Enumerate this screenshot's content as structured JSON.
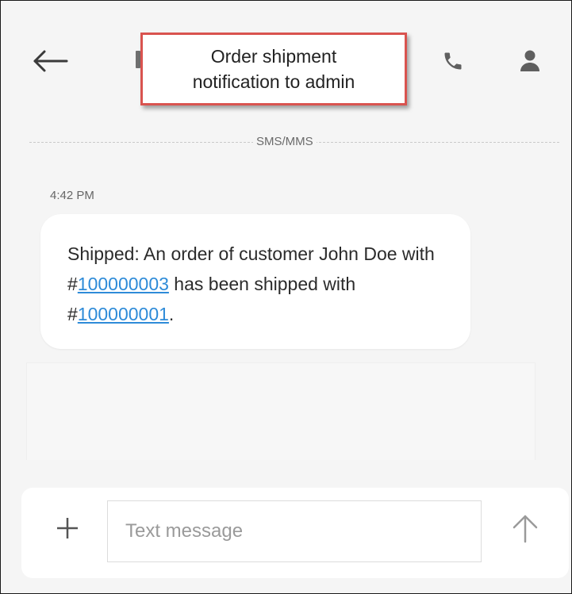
{
  "annotation": {
    "line1": "Order shipment",
    "line2": "notification to admin"
  },
  "conversation": {
    "channel_label": "SMS/MMS",
    "messages": [
      {
        "time": "4:42 PM",
        "text_part1": "Shipped: An order of customer John Doe with #",
        "order_number": "100000003",
        "text_part2": " has been shipped with #",
        "shipment_number": "100000001",
        "text_part3": "."
      }
    ]
  },
  "composer": {
    "placeholder": "Text message"
  },
  "icons": {
    "back": "arrow-left-icon",
    "call": "phone-icon",
    "contact": "person-icon",
    "add": "plus-icon",
    "send": "arrow-up-icon"
  },
  "colors": {
    "link": "#2e8bd8",
    "annotation_border": "#d9534f",
    "background": "#f5f5f5"
  }
}
